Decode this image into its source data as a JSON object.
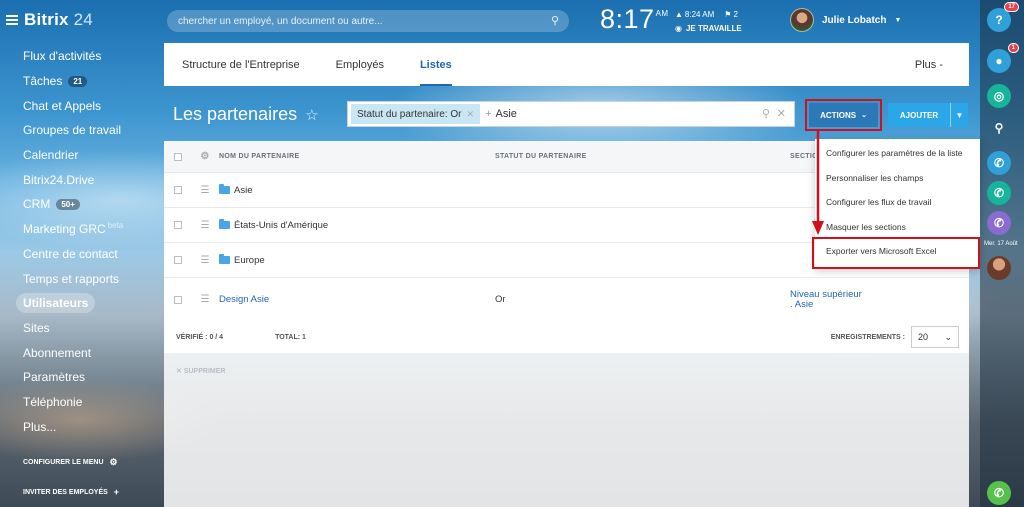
{
  "brand": {
    "name": "Bitrix",
    "suffix": "24"
  },
  "sidebar": {
    "items": [
      {
        "label": "Flux d'activités"
      },
      {
        "label": "Tâches",
        "badge": "21"
      },
      {
        "label": "Chat et Appels"
      },
      {
        "label": "Groupes de travail"
      },
      {
        "label": "Calendrier"
      },
      {
        "label": "Bitrix24.Drive"
      },
      {
        "label": "CRM",
        "badge": "50+"
      },
      {
        "label": "Marketing GRC",
        "sup": "beta"
      },
      {
        "label": "Centre de contact"
      },
      {
        "label": "Temps et rapports"
      },
      {
        "label": "Utilisateurs",
        "active": true
      },
      {
        "label": "Sites"
      },
      {
        "label": "Abonnement"
      },
      {
        "label": "Paramètres"
      },
      {
        "label": "Téléphonie"
      },
      {
        "label": "Plus..."
      }
    ],
    "configure_label": "CONFIGURER LE MENU",
    "invite_label": "INVITER DES EMPLOYÉS"
  },
  "topbar": {
    "search_placeholder": "chercher un employé, un document ou autre...",
    "time": "8:17",
    "ampm": "AM",
    "alarm_time": "8:24 AM",
    "people_count": "2",
    "work_status": "JE TRAVAILLE",
    "user_name": "Julie Lobatch"
  },
  "rightbar": {
    "help_badge": "17",
    "notif_badge": "1",
    "date_label": "Mer. 17 Août"
  },
  "tabs": [
    {
      "label": "Structure de l'Entreprise"
    },
    {
      "label": "Employés"
    },
    {
      "label": "Listes",
      "active": true
    }
  ],
  "tabs_more": "Plus",
  "page": {
    "title": "Les partenaires"
  },
  "filter": {
    "chip": "Statut du partenaire: Or",
    "value": "Asie"
  },
  "buttons": {
    "actions": "ACTIONS",
    "add": "AJOUTER"
  },
  "table": {
    "headers": [
      "NOM DU PARTENAIRE",
      "STATUT DU PARTENAIRE",
      "SECTION"
    ],
    "rows": [
      {
        "name": "Asie",
        "folder": true,
        "status": "",
        "section": ""
      },
      {
        "name": "États-Unis d'Amérique",
        "folder": true,
        "status": "",
        "section": ""
      },
      {
        "name": "Europe",
        "folder": true,
        "status": "",
        "section": ""
      },
      {
        "name": "Design Asie",
        "folder": false,
        "status": "Or",
        "section": "Niveau supérieur",
        "section2": ". Asie"
      }
    ]
  },
  "footer": {
    "checked_label": "VÉRIFIÉ : 0 / 4",
    "total_label": "TOTAL: 1",
    "records_label": "ENREGISTREMENTS :",
    "records_value": "20"
  },
  "delete_label": "SUPPRIMER",
  "actions_menu": [
    "Configurer les paramètres de la liste",
    "Personnaliser les champs",
    "Configurer les flux de travail",
    "Masquer les sections",
    "Exporter vers Microsoft Excel"
  ],
  "colors": {
    "highlight": "#d0101b",
    "accent": "#2067b0",
    "add_button": "#2ba6e8"
  }
}
